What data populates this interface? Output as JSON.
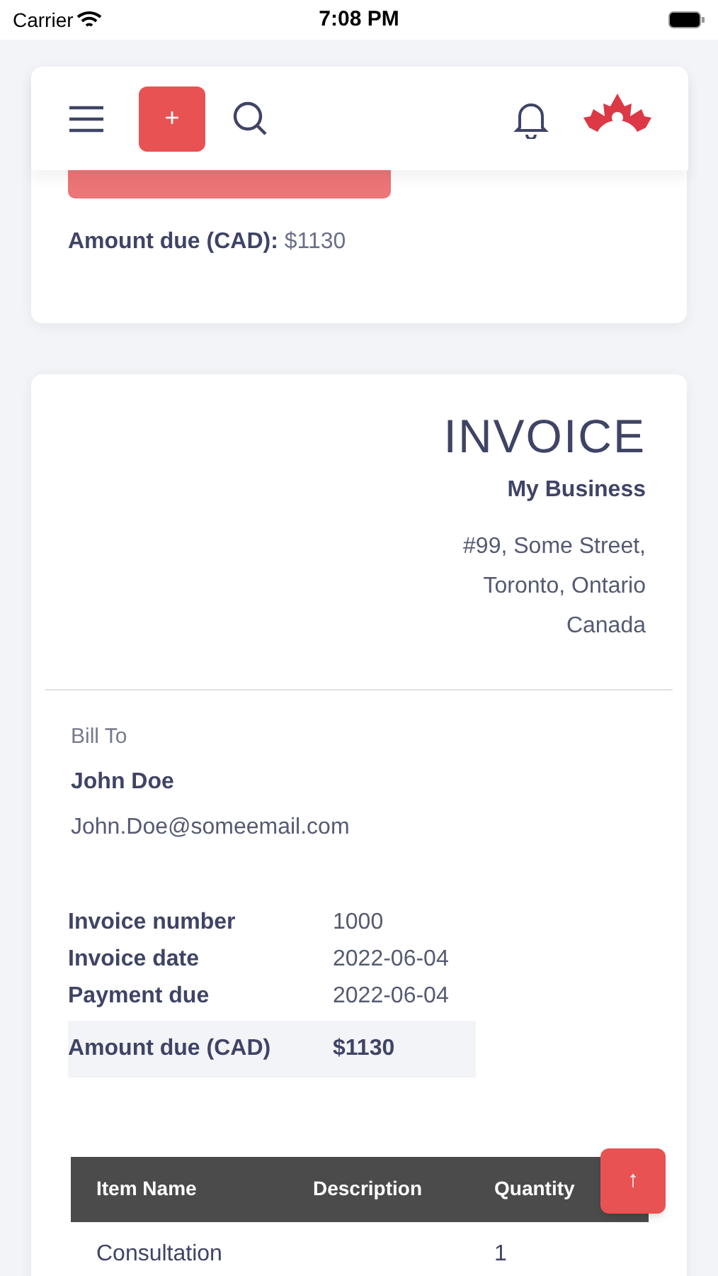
{
  "status_bar": {
    "carrier": "Carrier",
    "time": "7:08 PM"
  },
  "header": {
    "add_label": "+"
  },
  "summary": {
    "amount_label": "Amount due (CAD):",
    "amount_value": "$1130"
  },
  "invoice": {
    "title": "INVOICE",
    "business": "My Business",
    "address": [
      "#99, Some Street,",
      "Toronto, Ontario",
      "Canada"
    ],
    "bill_to_label": "Bill To",
    "client_name": "John Doe",
    "client_email": "John.Doe@someemail.com",
    "details": [
      {
        "label": "Invoice number",
        "value": "1000",
        "highlight": false
      },
      {
        "label": "Invoice date",
        "value": "2022-06-04",
        "highlight": false
      },
      {
        "label": "Payment due",
        "value": "2022-06-04",
        "highlight": false
      },
      {
        "label": "Amount due (CAD)",
        "value": "$1130",
        "highlight": true
      }
    ],
    "table": {
      "columns": [
        "Item Name",
        "Description",
        "Quantity"
      ],
      "rows": [
        [
          "Consultation",
          "",
          "1"
        ]
      ]
    }
  },
  "scroll_top_label": "↑"
}
